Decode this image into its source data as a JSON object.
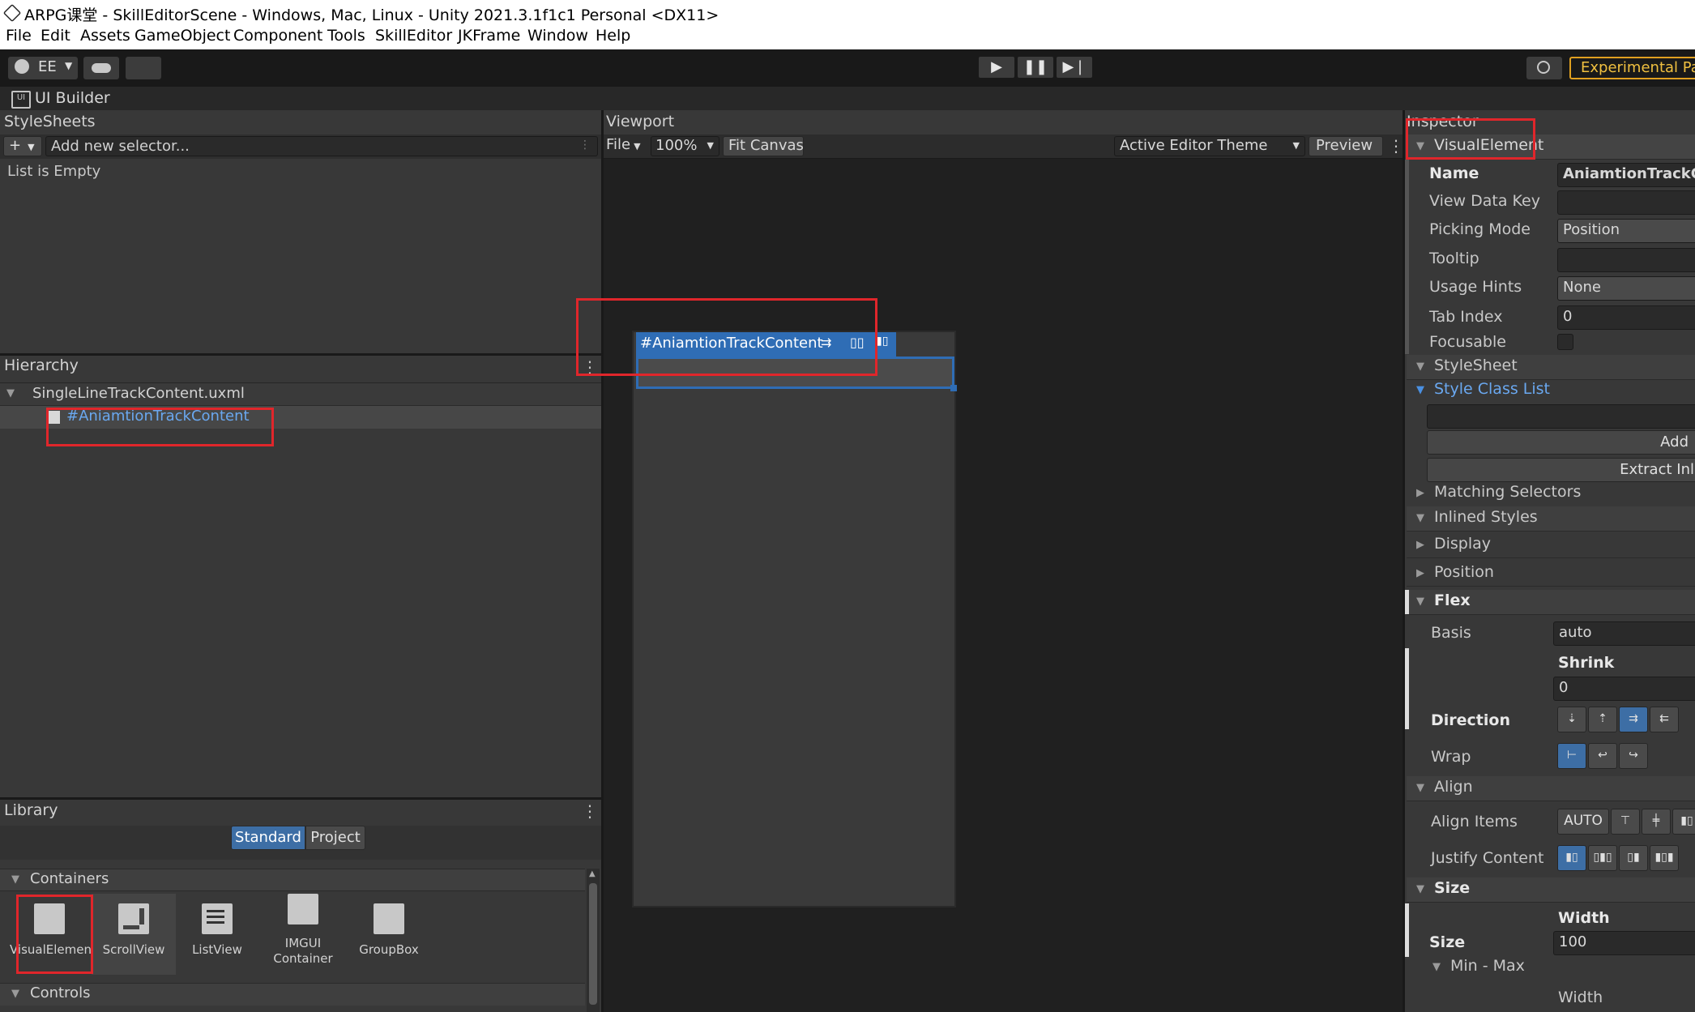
{
  "window": {
    "title": "ARPG课堂 - SkillEditorScene - Windows, Mac, Linux - Unity 2021.3.1f1c1 Personal <DX11>"
  },
  "menu": [
    "File",
    "Edit",
    "Assets",
    "GameObject",
    "Component",
    "Tools",
    "SkillEditor",
    "JKFrame",
    "Window",
    "Help"
  ],
  "toolbar": {
    "account": "EE",
    "experimental": "Experimental Pac"
  },
  "ui_builder": {
    "tab_label": "UI Builder"
  },
  "stylesheets": {
    "header": "StyleSheets",
    "selector_placeholder": "Add new selector...",
    "empty_text": "List is Empty"
  },
  "hierarchy": {
    "header": "Hierarchy",
    "root": "SingleLineTrackContent.uxml",
    "child": "#AniamtionTrackContent"
  },
  "library": {
    "header": "Library",
    "tabs": [
      "Standard",
      "Project"
    ],
    "containers_label": "Containers",
    "items": [
      "VisualElement",
      "ScrollView",
      "ListView",
      "IMGUI\nContainer",
      "GroupBox"
    ],
    "controls_label": "Controls"
  },
  "viewport": {
    "header": "Viewport",
    "file": "File",
    "zoom": "100%",
    "fit": "Fit Canvas",
    "theme": "Active Editor Theme",
    "preview": "Preview",
    "element_label": "#AniamtionTrackContent"
  },
  "inspector": {
    "header": "Inspector",
    "type": "VisualElement",
    "name_label": "Name",
    "name_value": "AniamtionTrackCo",
    "view_data_key_label": "View Data Key",
    "picking_mode_label": "Picking Mode",
    "picking_mode_value": "Position",
    "tooltip_label": "Tooltip",
    "usage_hints_label": "Usage Hints",
    "usage_hints_value": "None",
    "tab_index_label": "Tab Index",
    "tab_index_value": "0",
    "focusable_label": "Focusable",
    "stylesheet_label": "StyleSheet",
    "style_class_list_label": "Style Class List",
    "add_label": "Add",
    "extract_label": "Extract Inli",
    "matching_selectors_label": "Matching Selectors",
    "inlined_styles_label": "Inlined Styles",
    "display_label": "Display",
    "position_label": "Position",
    "flex_label": "Flex",
    "basis_label": "Basis",
    "basis_value": "auto",
    "shrink_label": "Shrink",
    "shrink_value": "0",
    "direction_label": "Direction",
    "wrap_label": "Wrap",
    "align_label": "Align",
    "align_items_label": "Align Items",
    "align_items_value": "AUTO",
    "justify_content_label": "Justify Content",
    "size_section_label": "Size",
    "width_label": "Width",
    "size_label": "Size",
    "size_value": "100",
    "minmax_label": "Min - Max",
    "width_label2": "Width"
  }
}
